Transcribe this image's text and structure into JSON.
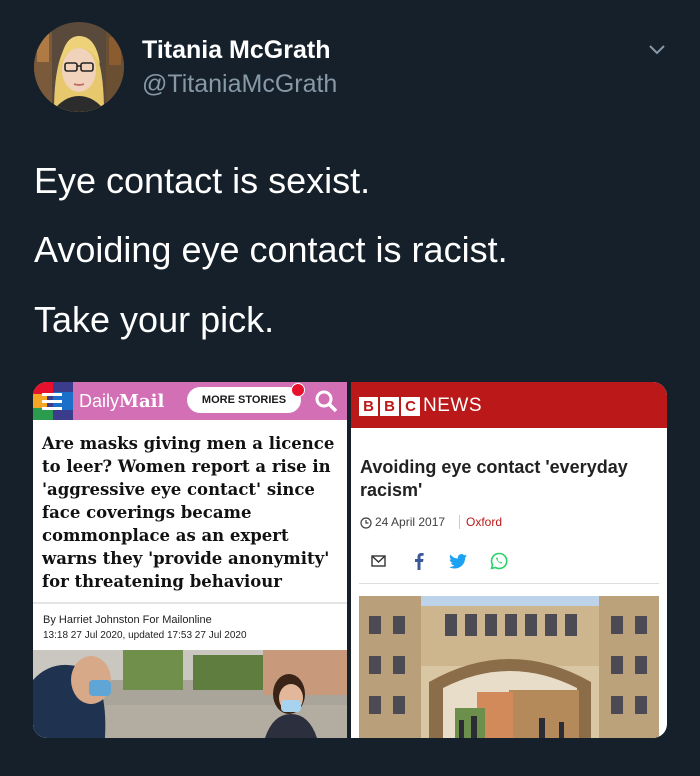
{
  "tweet": {
    "author_name": "Titania McGrath",
    "author_handle": "@TitaniaMcGrath",
    "lines": [
      "Eye contact is sexist.",
      "Avoiding eye contact is racist.",
      "Take your pick."
    ]
  },
  "left_card": {
    "brand_prefix": "Daily",
    "brand_name": "Mail",
    "more_stories": "MORE STORIES",
    "headline": "Are masks giving men a licence to leer? Women report a rise in 'aggressive eye contact' since face coverings became commonplace as an expert warns they 'provide anonymity' for threatening behaviour",
    "byline": "By Harriet Johnston For Mailonline",
    "dateline": "13:18 27 Jul 2020, updated 17:53 27 Jul 2020"
  },
  "right_card": {
    "letters": [
      "B",
      "B",
      "C"
    ],
    "news_label": "NEWS",
    "headline": "Avoiding eye contact 'everyday racism'",
    "date": "24 April 2017",
    "tag": "Oxford"
  },
  "colors": {
    "background": "#15202b",
    "muted_text": "#8899a6",
    "dailymail_bar": "#d36fb5",
    "bbc_red": "#bb1919"
  },
  "icons": [
    "chevron-down-icon",
    "menu-icon",
    "search-icon",
    "clock-icon",
    "email-icon",
    "facebook-icon",
    "twitter-icon",
    "whatsapp-icon"
  ]
}
